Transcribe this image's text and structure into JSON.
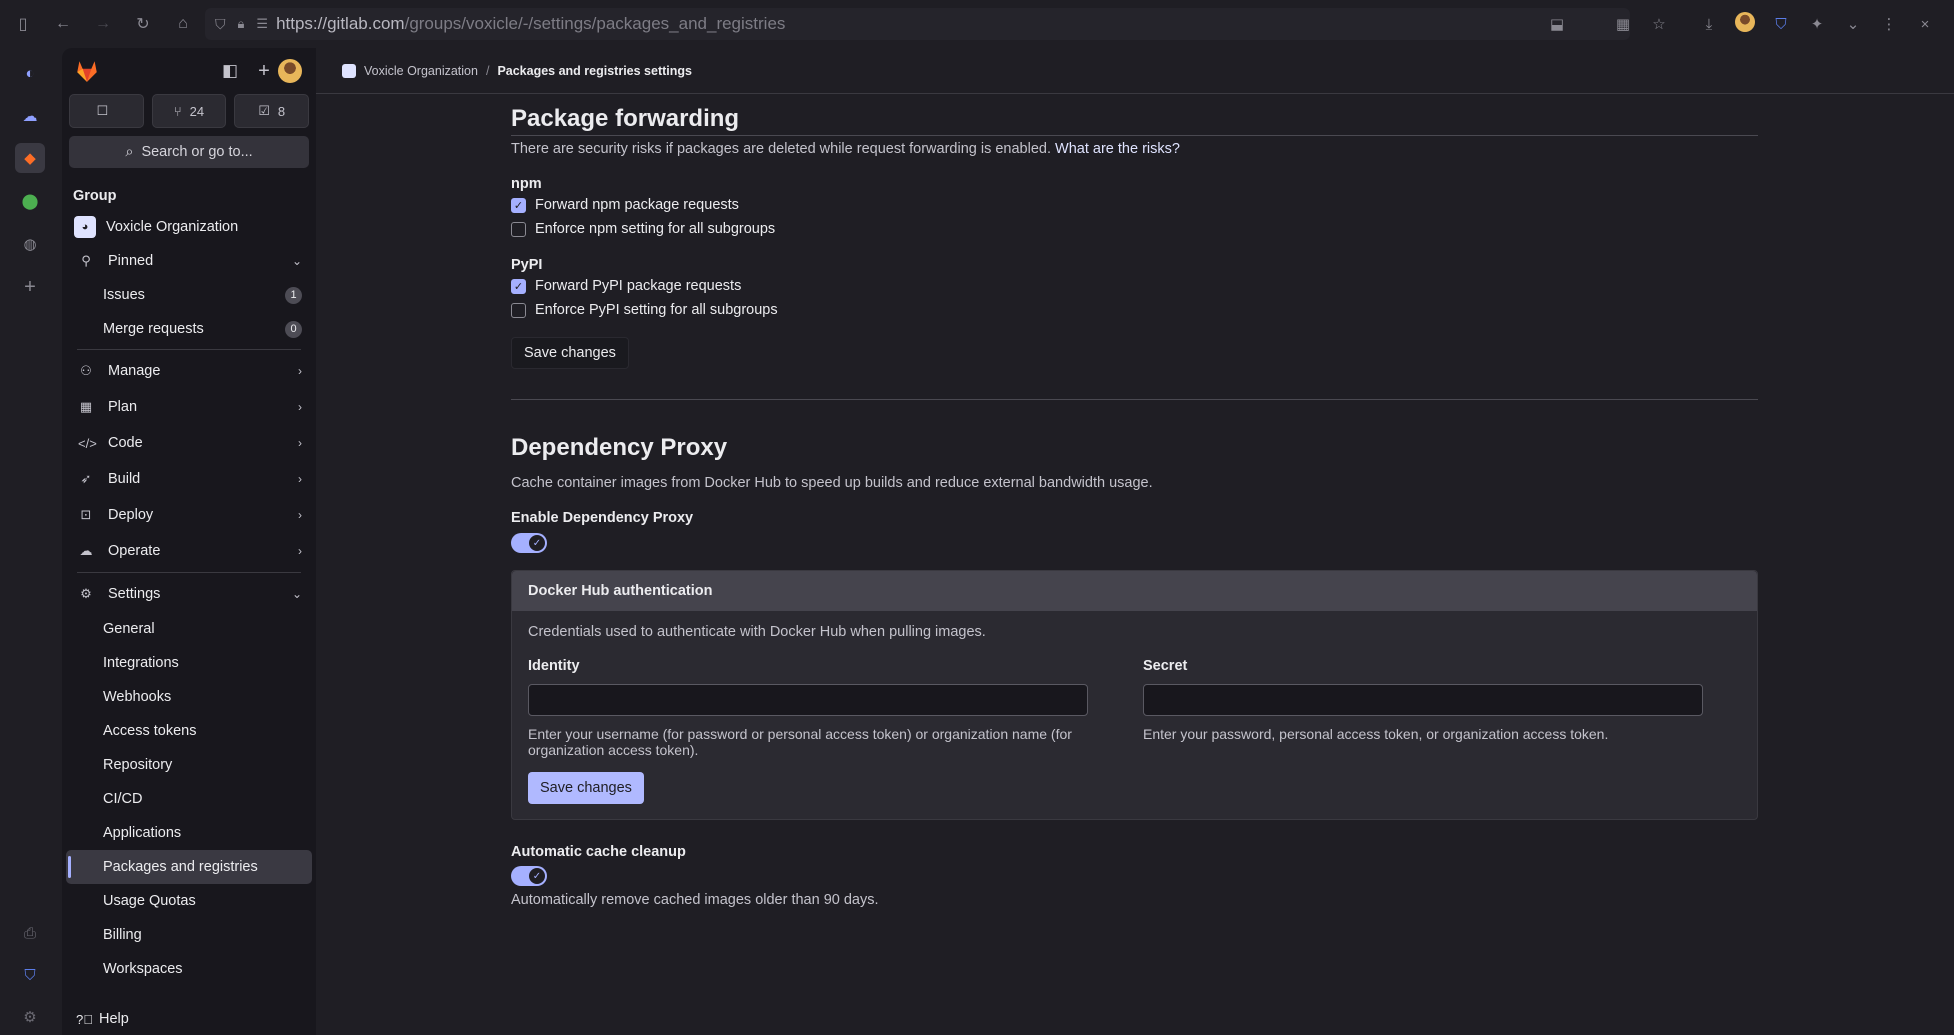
{
  "browser": {
    "url_host": "https://gitlab.com",
    "url_path": "/groups/voxicle/-/settings/packages_and_registries"
  },
  "sidebar": {
    "counters": [
      {
        "icon": "todo-icon",
        "value": ""
      },
      {
        "icon": "merge-request-icon",
        "value": "24"
      },
      {
        "icon": "issues-icon",
        "value": "8"
      }
    ],
    "search_label": "Search or go to...",
    "heading": "Group",
    "group_name": "Voxicle Organization",
    "pinned": "Pinned",
    "pinned_items": [
      {
        "label": "Issues",
        "count": "1"
      },
      {
        "label": "Merge requests",
        "count": "0"
      }
    ],
    "sections": [
      "Manage",
      "Plan",
      "Code",
      "Build",
      "Deploy",
      "Operate"
    ],
    "settings": "Settings",
    "settings_items": [
      "General",
      "Integrations",
      "Webhooks",
      "Access tokens",
      "Repository",
      "CI/CD",
      "Applications",
      "Packages and registries",
      "Usage Quotas",
      "Billing",
      "Workspaces"
    ],
    "help": "Help"
  },
  "breadcrumb": {
    "group": "Voxicle Organization",
    "separator": "/",
    "current": "Packages and registries settings"
  },
  "package_forwarding": {
    "title": "Package forwarding",
    "description": "There are security risks if packages are deleted while request forwarding is enabled.",
    "risk_link": "What are the risks?",
    "npm_label": "npm",
    "npm_forward": "Forward npm package requests",
    "npm_forward_checked": true,
    "npm_enforce": "Enforce npm setting for all subgroups",
    "npm_enforce_checked": false,
    "pypi_label": "PyPI",
    "pypi_forward": "Forward PyPI package requests",
    "pypi_forward_checked": true,
    "pypi_enforce": "Enforce PyPI setting for all subgroups",
    "pypi_enforce_checked": false,
    "save": "Save changes"
  },
  "dependency_proxy": {
    "title": "Dependency Proxy",
    "description": "Cache container images from Docker Hub to speed up builds and reduce external bandwidth usage.",
    "enable_label": "Enable Dependency Proxy",
    "enabled": true,
    "auth_title": "Docker Hub authentication",
    "auth_description": "Credentials used to authenticate with Docker Hub when pulling images.",
    "identity_label": "Identity",
    "identity_value": "",
    "identity_help": "Enter your username (for password or personal access token) or organization name (for organization access token).",
    "secret_label": "Secret",
    "secret_value": "",
    "secret_help": "Enter your password, personal access token, or organization access token.",
    "save": "Save changes",
    "cleanup_label": "Automatic cache cleanup",
    "cleanup_enabled": true,
    "cleanup_help": "Automatically remove cached images older than 90 days."
  },
  "colors": {
    "accent": "#a5b0ff",
    "background": "#1f1e24",
    "sidebar": "#18171d"
  }
}
